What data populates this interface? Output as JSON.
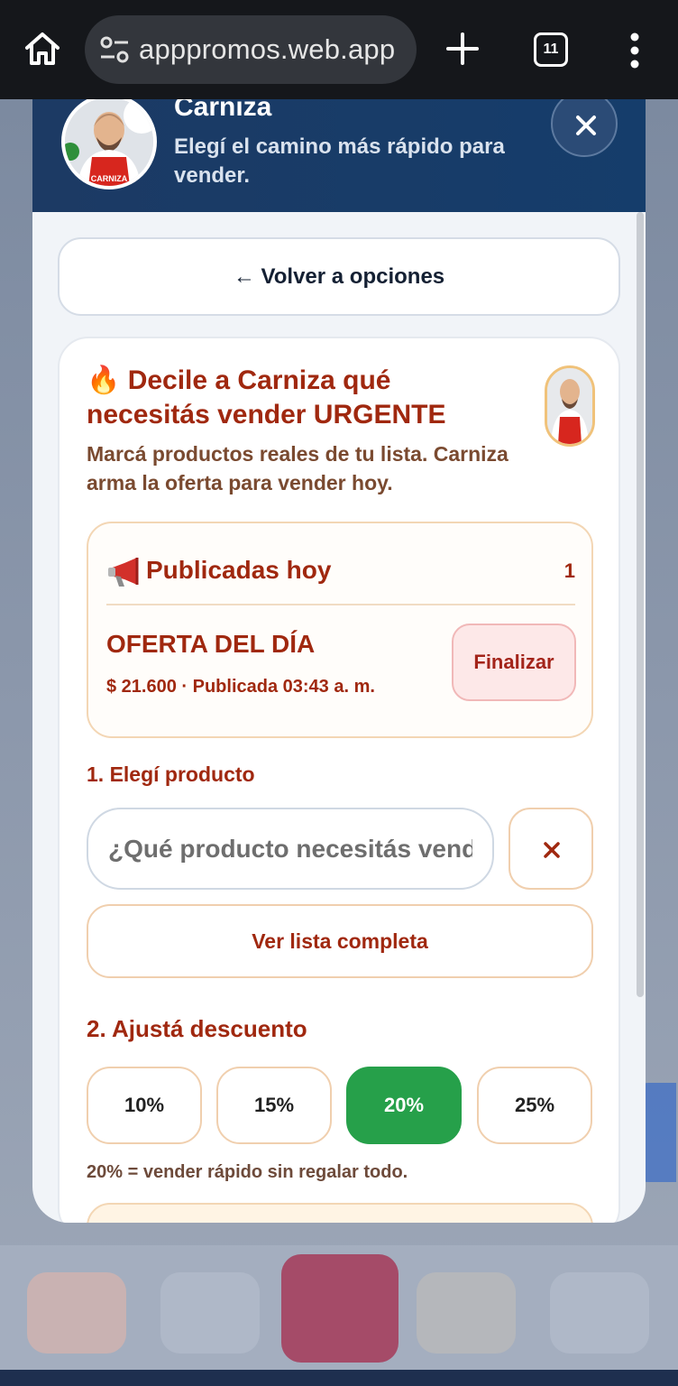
{
  "browser": {
    "url": "apppromos.web.app",
    "tab_count": "11"
  },
  "modal": {
    "title": "Carniza",
    "subtitle": "Elegí el camino más rápido para vender.",
    "back_label": "← Volver a opciones",
    "apron_text": "CARNIZA"
  },
  "card": {
    "title": "🔥 Decile a Carniza qué necesitás vender URGENTE",
    "description": "Marcá productos reales de tu lista. Carniza arma la oferta para vender hoy.",
    "published": {
      "title": "Publicadas hoy",
      "count": "1",
      "offer_name": "OFERTA DEL DÍA",
      "offer_meta": "$ 21.600 · Publicada 03:43 a. m.",
      "finalize_label": "Finalizar"
    },
    "step1_label": "1. Elegí producto",
    "search_placeholder": "¿Qué producto necesitás vender?",
    "full_list_label": "Ver lista completa",
    "step2_label": "2. Ajustá descuento",
    "discounts": [
      "10%",
      "15%",
      "20%",
      "25%"
    ],
    "selected_discount": "20%",
    "discount_hint": "20% = vender rápido sin regalar todo."
  },
  "colors": {
    "accent_red": "#a0280f",
    "header_blue": "#1c3a64",
    "active_green": "#26a04a"
  }
}
